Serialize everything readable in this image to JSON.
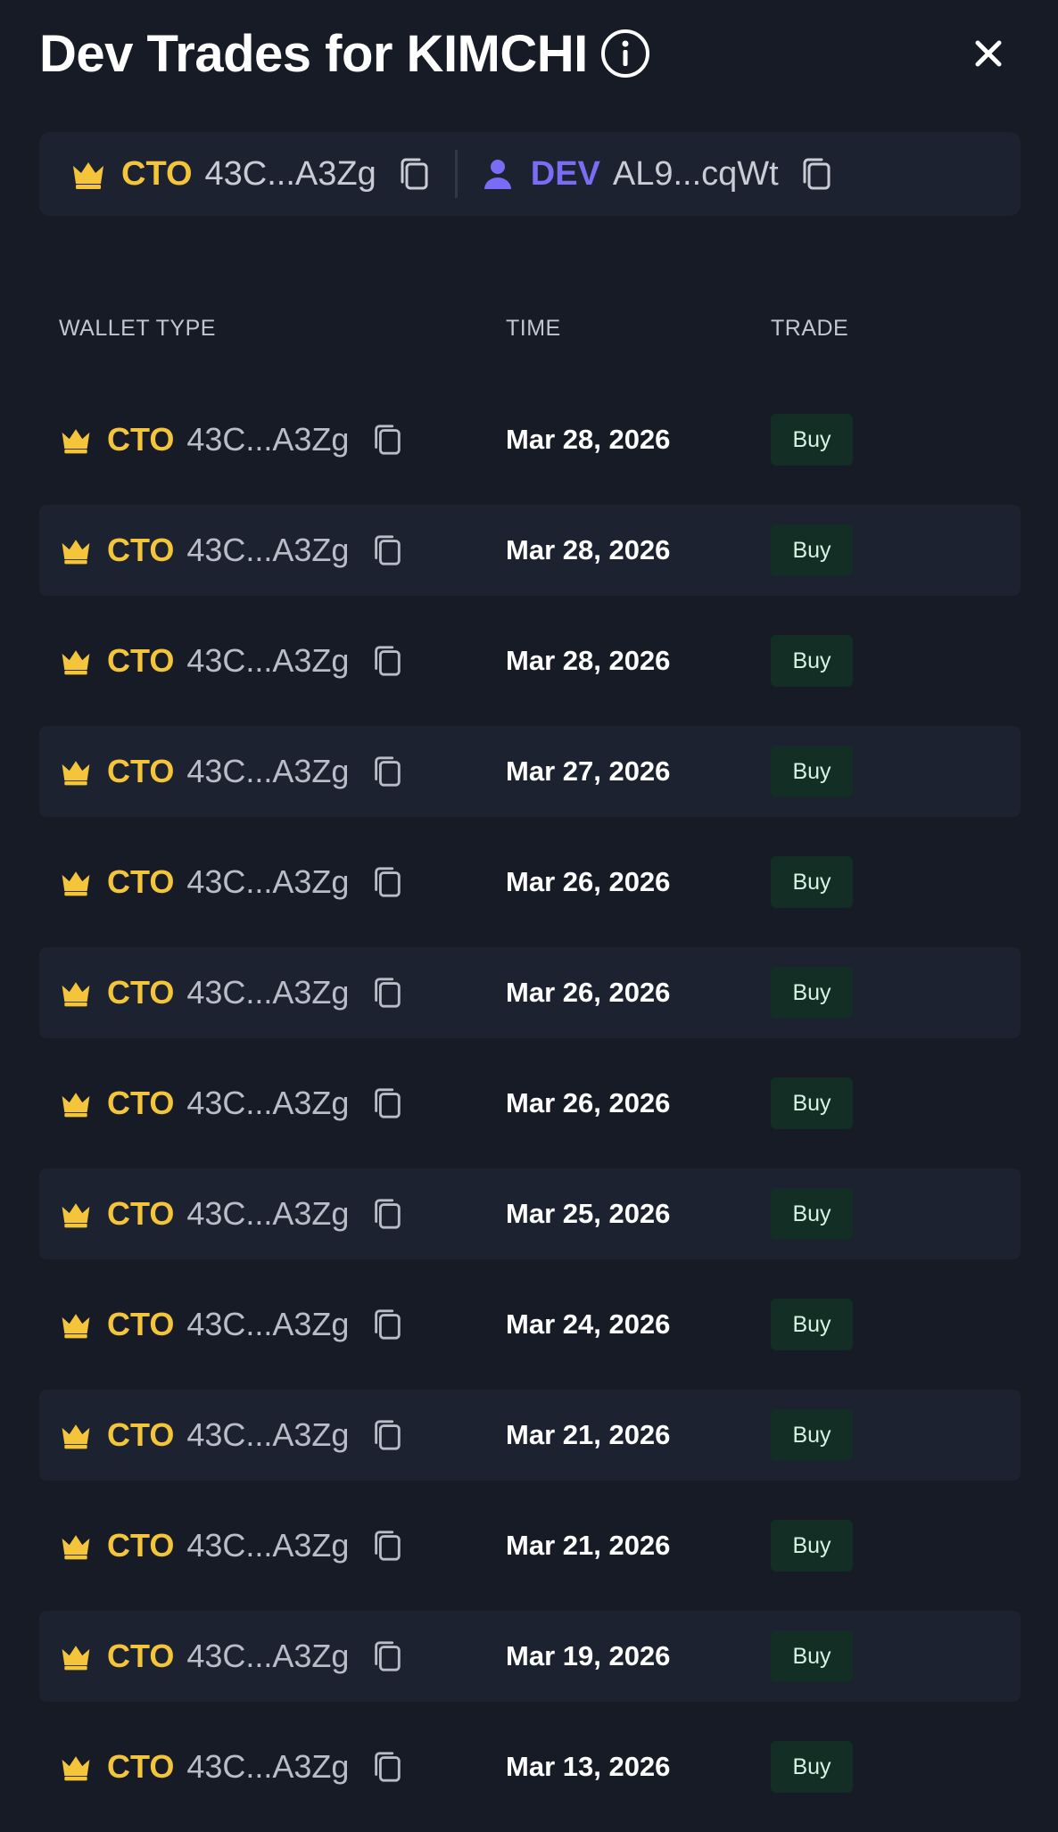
{
  "header": {
    "title": "Dev Trades for KIMCHI",
    "info_icon": "info-icon",
    "close_icon": "close-icon"
  },
  "wallets": {
    "cto": {
      "label": "CTO",
      "address": "43C...A3Zg",
      "icon": "crown-icon"
    },
    "dev": {
      "label": "DEV",
      "address": "AL9...cqWt",
      "icon": "user-icon"
    }
  },
  "table": {
    "headers": {
      "wallet_type": "WALLET TYPE",
      "time": "TIME",
      "trade": "TRADE"
    },
    "rows": [
      {
        "label": "CTO",
        "address": "43C...A3Zg",
        "time": "Mar 28, 2026",
        "trade": "Buy"
      },
      {
        "label": "CTO",
        "address": "43C...A3Zg",
        "time": "Mar 28, 2026",
        "trade": "Buy"
      },
      {
        "label": "CTO",
        "address": "43C...A3Zg",
        "time": "Mar 28, 2026",
        "trade": "Buy"
      },
      {
        "label": "CTO",
        "address": "43C...A3Zg",
        "time": "Mar 27, 2026",
        "trade": "Buy"
      },
      {
        "label": "CTO",
        "address": "43C...A3Zg",
        "time": "Mar 26, 2026",
        "trade": "Buy"
      },
      {
        "label": "CTO",
        "address": "43C...A3Zg",
        "time": "Mar 26, 2026",
        "trade": "Buy"
      },
      {
        "label": "CTO",
        "address": "43C...A3Zg",
        "time": "Mar 26, 2026",
        "trade": "Buy"
      },
      {
        "label": "CTO",
        "address": "43C...A3Zg",
        "time": "Mar 25, 2026",
        "trade": "Buy"
      },
      {
        "label": "CTO",
        "address": "43C...A3Zg",
        "time": "Mar 24, 2026",
        "trade": "Buy"
      },
      {
        "label": "CTO",
        "address": "43C...A3Zg",
        "time": "Mar 21, 2026",
        "trade": "Buy"
      },
      {
        "label": "CTO",
        "address": "43C...A3Zg",
        "time": "Mar 21, 2026",
        "trade": "Buy"
      },
      {
        "label": "CTO",
        "address": "43C...A3Zg",
        "time": "Mar 19, 2026",
        "trade": "Buy"
      },
      {
        "label": "CTO",
        "address": "43C...A3Zg",
        "time": "Mar 13, 2026",
        "trade": "Buy"
      }
    ]
  },
  "colors": {
    "background": "#161b26",
    "panel": "#1c2230",
    "cto": "#f4c53a",
    "dev": "#7b6cf6",
    "buy_bg": "#132e24"
  }
}
